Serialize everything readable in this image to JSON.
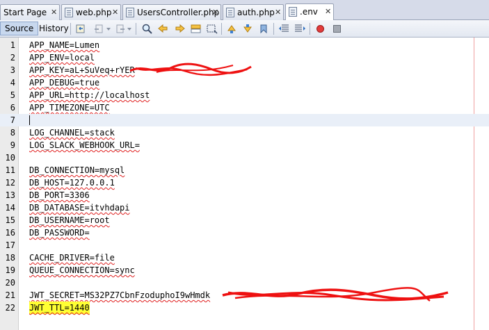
{
  "tabs": [
    {
      "label": "Start Page",
      "has_icon": false
    },
    {
      "label": "web.php",
      "has_icon": true
    },
    {
      "label": "UsersController.php",
      "has_icon": true
    },
    {
      "label": "auth.php",
      "has_icon": true
    },
    {
      "label": ".env",
      "has_icon": true,
      "active": true
    }
  ],
  "tab_close_glyph": "✕",
  "toolbar": {
    "source_label": "Source",
    "history_label": "History"
  },
  "editor": {
    "current_line": 7,
    "lines": [
      {
        "n": "1",
        "text": "APP_NAME=Lumen"
      },
      {
        "n": "2",
        "text": "APP_ENV=local"
      },
      {
        "n": "3",
        "text": "APP_KEY=aL+SuVeq+rYER"
      },
      {
        "n": "4",
        "text": "APP_DEBUG=true"
      },
      {
        "n": "5",
        "text": "APP_URL=http://localhost"
      },
      {
        "n": "6",
        "text": "APP_TIMEZONE=UTC"
      },
      {
        "n": "7",
        "text": ""
      },
      {
        "n": "8",
        "text": "LOG_CHANNEL=stack"
      },
      {
        "n": "9",
        "text": "LOG_SLACK_WEBHOOK_URL="
      },
      {
        "n": "10",
        "text": ""
      },
      {
        "n": "11",
        "text": "DB_CONNECTION=mysql"
      },
      {
        "n": "12",
        "text": "DB_HOST=127.0.0.1"
      },
      {
        "n": "13",
        "text": "DB_PORT=3306"
      },
      {
        "n": "14",
        "text": "DB_DATABASE=itvhdapi"
      },
      {
        "n": "15",
        "text": "DB_USERNAME=root"
      },
      {
        "n": "16",
        "text": "DB_PASSWORD="
      },
      {
        "n": "17",
        "text": ""
      },
      {
        "n": "18",
        "text": "CACHE_DRIVER=file"
      },
      {
        "n": "19",
        "text": "QUEUE_CONNECTION=sync"
      },
      {
        "n": "20",
        "text": ""
      },
      {
        "n": "21",
        "text": "JWT_SECRET=MS32PZ7CbnFzoduphoI9wHmdk"
      },
      {
        "n": "22",
        "text": "JWT_TTL=1440",
        "highlighted": true
      }
    ]
  },
  "colors": {
    "highlight": "#ffff33",
    "redaction": "#ee1111",
    "spell_squiggle": "#e02020"
  }
}
